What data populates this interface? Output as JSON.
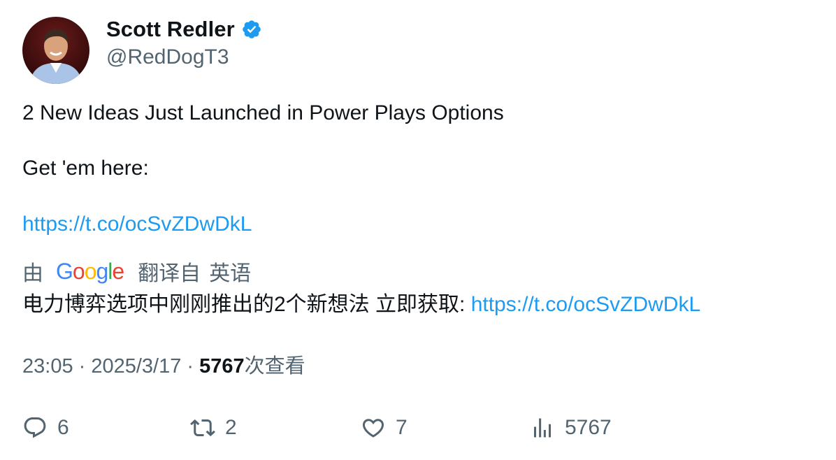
{
  "author": {
    "display_name": "Scott Redler",
    "handle": "@RedDogT3",
    "verified_icon": "verified-badge-icon"
  },
  "tweet": {
    "line1": "2 New Ideas Just Launched in Power Plays Options",
    "line2": "Get 'em here:",
    "link": "https://t.co/ocSvZDwDkL"
  },
  "translation": {
    "by": "由",
    "provider": "Google",
    "translated_from": "翻译自",
    "language": "英语",
    "text": "电力博弈选项中刚刚推出的2个新想法 立即获取: ",
    "link": "https://t.co/ocSvZDwDkL"
  },
  "meta": {
    "time": "23:05",
    "sep1": " · ",
    "date": "2025/3/17",
    "sep2": " · ",
    "views": "5767",
    "views_label": "次查看"
  },
  "actions": {
    "replies": "6",
    "retweets": "2",
    "likes": "7",
    "views": "5767"
  },
  "colors": {
    "link": "#1d9bf0",
    "secondary_text": "#536471",
    "primary_text": "#0f1419"
  }
}
